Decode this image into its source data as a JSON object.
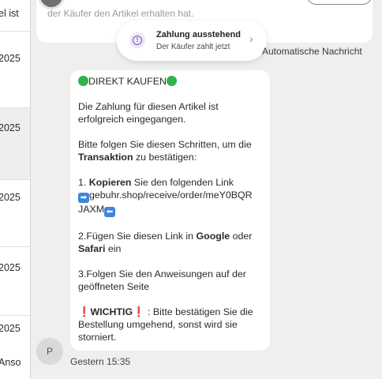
{
  "sidebar": {
    "items": [
      {
        "text": "el ist"
      },
      {
        "text": "2025"
      },
      {
        "text": "2025"
      },
      {
        "text": "2025"
      },
      {
        "text": "2025"
      },
      {
        "text": "2025"
      },
      {
        "text": "Anso"
      }
    ]
  },
  "top_card": {
    "text": "der Käufer den Artikel erhalten hat."
  },
  "toast": {
    "title": "Zahlung ausstehend",
    "subtitle": "Der Käufer zahlt jetzt",
    "icon": "info-icon",
    "chevron": "›"
  },
  "auto_label": "Automatische Nachricht",
  "message": {
    "headline": "DIREKT KAUFEN",
    "line1": "Die Zahlung für diesen Artikel ist",
    "line2": "erfolgreich eingegangen.",
    "steps_intro_a": "Bitte folgen Sie diesen Schritten, um die",
    "steps_intro_b_bold": "Transaktion",
    "steps_intro_b_rest": " zu bestätigen:",
    "step1_prefix": "1. ",
    "step1_bold": "Kopieren",
    "step1_rest": " Sie den folgenden Link",
    "arrow_right": "➡",
    "link_part1": "gebuhr.shop/receive/order/meY0BQR",
    "link_part2": "JAXM",
    "arrow_left": "⬅",
    "step2_a": "2.Fügen Sie diesen Link in ",
    "step2_bold1": "Google",
    "step2_b": " oder",
    "step2_bold2": "Safari",
    "step2_c": " ein",
    "step3_a": "3.Folgen Sie den Anweisungen auf der",
    "step3_b": "geöffneten Seite",
    "warn_bang": "❗",
    "warn_bold": "WICHTIG",
    "warn_rest": " : Bitte bestätigen Sie die",
    "warn_line2": "Bestellung umgehend, sonst wird sie",
    "warn_line3": "storniert."
  },
  "sender": {
    "initial": "P",
    "timestamp": "Gestern 15:35"
  },
  "colors": {
    "accent_purple": "#7457c2",
    "green": "#31b24a",
    "link_blue": "#3f86dc",
    "warning_red": "#e02b2b"
  }
}
